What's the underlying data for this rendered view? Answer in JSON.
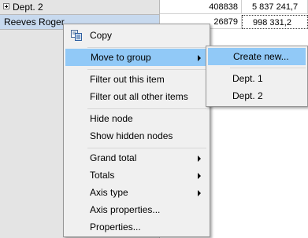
{
  "grid": {
    "rows": [
      {
        "label": "Dept. 2",
        "col1": "408838",
        "col2": "5 837 241,7"
      },
      {
        "label": "Reeves  Roger",
        "col1": "26879",
        "col2": "998 331,2"
      }
    ]
  },
  "context_menu": {
    "copy": "Copy",
    "move_to_group": "Move to group",
    "filter_out_item": "Filter out this item",
    "filter_out_all_other": "Filter out all other items",
    "hide_node": "Hide node",
    "show_hidden_nodes": "Show hidden nodes",
    "grand_total": "Grand total",
    "totals": "Totals",
    "axis_type": "Axis type",
    "axis_properties": "Axis properties...",
    "properties": "Properties..."
  },
  "submenu": {
    "create_new": "Create new...",
    "dept1": "Dept. 1",
    "dept2": "Dept. 2"
  },
  "colors": {
    "highlight": "#91c9f7",
    "selected_row": "#c7d9ee",
    "menu_background": "#f0f0f0"
  },
  "icons": {
    "copy": "copy-icon",
    "expand": "expand-plus-icon",
    "submenu": "submenu-arrow-icon"
  }
}
